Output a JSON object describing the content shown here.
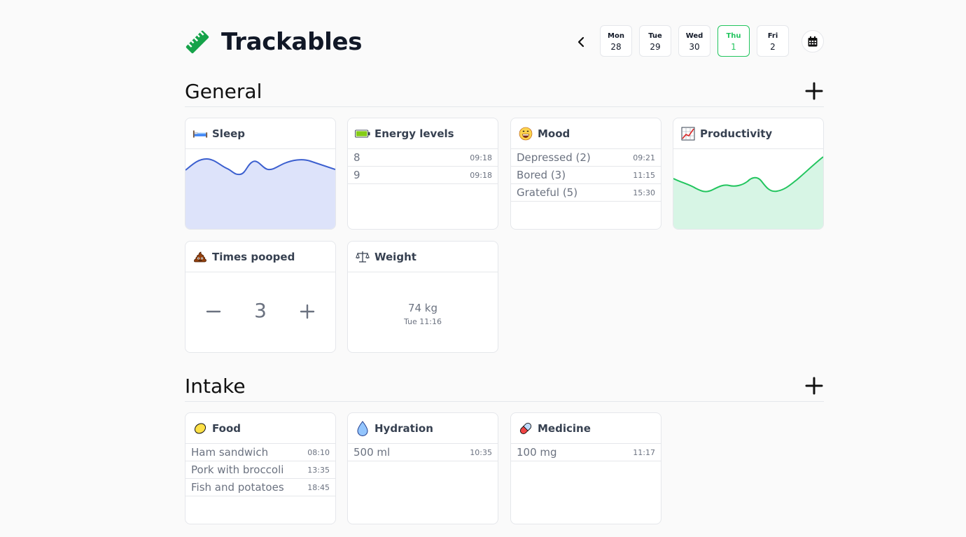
{
  "app": {
    "title": "Trackables",
    "logo_icon": "ruler-icon",
    "accent": "#22c55e"
  },
  "days": [
    {
      "name": "Mon",
      "num": "28"
    },
    {
      "name": "Tue",
      "num": "29"
    },
    {
      "name": "Wed",
      "num": "30"
    },
    {
      "name": "Thu",
      "num": "1",
      "active": true
    },
    {
      "name": "Fri",
      "num": "2"
    }
  ],
  "sections": {
    "general": {
      "title": "General"
    },
    "intake": {
      "title": "Intake"
    }
  },
  "cards": {
    "sleep": {
      "title": "Sleep",
      "icon": "bed-icon",
      "color": "#3b5fcf",
      "fill": "#dde3fa"
    },
    "energy": {
      "title": "Energy levels",
      "icon": "battery-icon",
      "entries": [
        {
          "value": "8",
          "time": "09:18"
        },
        {
          "value": "9",
          "time": "09:18"
        }
      ]
    },
    "mood": {
      "title": "Mood",
      "icon": "grinning-face-icon",
      "entries": [
        {
          "value": "Depressed (2)",
          "time": "09:21"
        },
        {
          "value": "Bored (3)",
          "time": "11:15"
        },
        {
          "value": "Grateful (5)",
          "time": "15:30"
        }
      ]
    },
    "productivity": {
      "title": "Productivity",
      "icon": "chart-increasing-icon",
      "color": "#22c55e",
      "fill": "#d7f5e5"
    },
    "poop": {
      "title": "Times pooped",
      "icon": "pile-of-poo-icon",
      "count": "3"
    },
    "weight": {
      "title": "Weight",
      "icon": "balance-scale-icon",
      "value": "74 kg",
      "time": "Tue 11:16"
    },
    "food": {
      "title": "Food",
      "icon": "lemon-icon",
      "entries": [
        {
          "value": "Ham sandwich",
          "time": "08:10"
        },
        {
          "value": "Pork with broccoli",
          "time": "13:35"
        },
        {
          "value": "Fish and potatoes",
          "time": "18:45"
        }
      ]
    },
    "hydration": {
      "title": "Hydration",
      "icon": "droplet-icon",
      "entries": [
        {
          "value": "500 ml",
          "time": "10:35"
        }
      ]
    },
    "medicine": {
      "title": "Medicine",
      "icon": "pill-icon",
      "entries": [
        {
          "value": "100 mg",
          "time": "11:17"
        }
      ]
    }
  }
}
